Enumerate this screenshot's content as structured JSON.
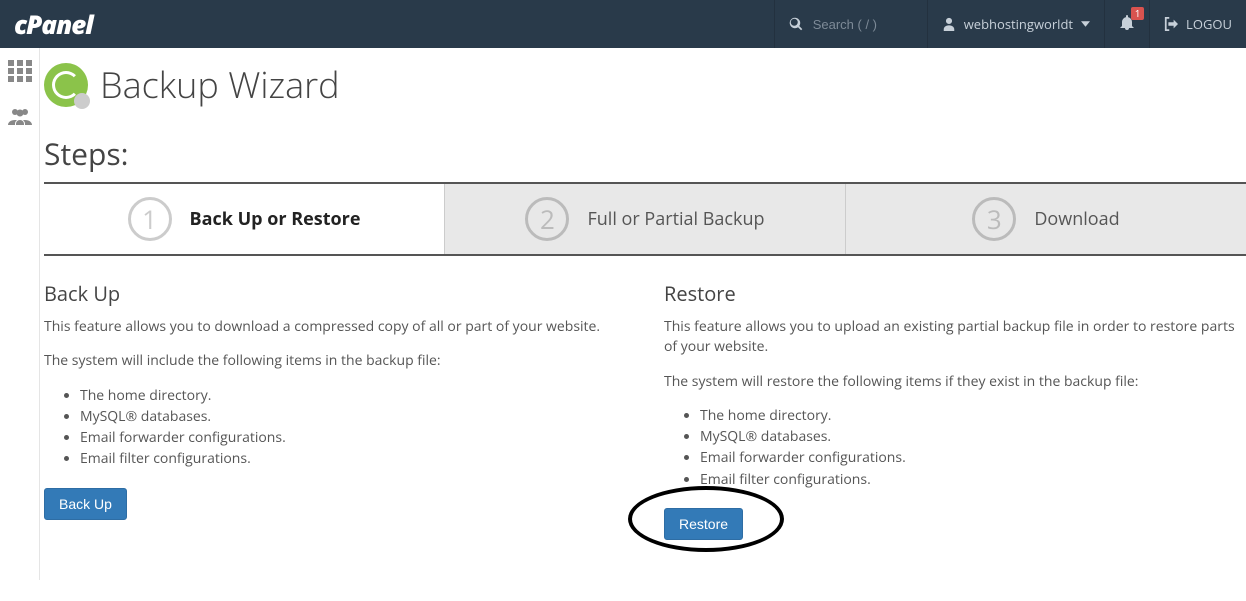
{
  "brand": "cPanel",
  "search": {
    "placeholder": "Search ( / )"
  },
  "user": {
    "name": "webhostingworldt"
  },
  "notifications": {
    "count": "1"
  },
  "logout_label": "LOGOU",
  "page": {
    "title": "Backup Wizard",
    "steps_heading": "Steps:"
  },
  "steps": [
    {
      "num": "1",
      "label": "Back Up or Restore",
      "active": true
    },
    {
      "num": "2",
      "label": "Full or Partial Backup",
      "active": false
    },
    {
      "num": "3",
      "label": "Download",
      "active": false
    }
  ],
  "backup": {
    "heading": "Back Up",
    "desc": "This feature allows you to download a compressed copy of all or part of your website.",
    "list_intro": "The system will include the following items in the backup file:",
    "items": [
      "The home directory.",
      "MySQL® databases.",
      "Email forwarder configurations.",
      "Email filter configurations."
    ],
    "button": "Back Up"
  },
  "restore": {
    "heading": "Restore",
    "desc": "This feature allows you to upload an existing partial backup file in order to restore parts of your website.",
    "list_intro": "The system will restore the following items if they exist in the backup file:",
    "items": [
      "The home directory.",
      "MySQL® databases.",
      "Email forwarder configurations.",
      "Email filter configurations."
    ],
    "button": "Restore"
  }
}
